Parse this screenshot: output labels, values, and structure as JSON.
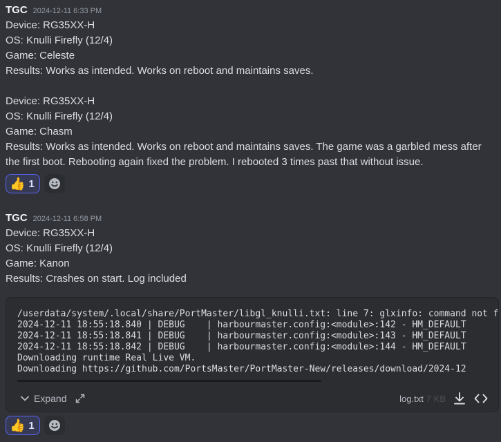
{
  "messages": [
    {
      "author": "TGC",
      "timestamp": "2024-12-11 6:33 PM",
      "block1": [
        "Device: RG35XX-H",
        "OS: Knulli Firefly (12/4)",
        "Game: Celeste",
        "Results: Works as intended. Works on reboot and maintains saves."
      ],
      "block2": [
        "Device: RG35XX-H",
        "OS: Knulli Firefly (12/4)",
        "Game: Chasm"
      ],
      "block2_results": "Results: Works as intended. Works on reboot and maintains saves. The game was a garbled mess after the first boot. Rebooting again fixed the problem. I rebooted 3 times past that without issue.",
      "reaction": {
        "emoji": "👍",
        "count": "1"
      }
    },
    {
      "author": "TGC",
      "timestamp": "2024-12-11 6:58 PM",
      "lines": [
        "Device: RG35XX-H",
        "OS: Knulli Firefly (12/4)",
        "Game: Kanon",
        "Results: Crashes on start. Log included"
      ],
      "attachment": {
        "preview_lines": [
          "/userdata/system/.local/share/PortMaster/libgl_knulli.txt: line 7: glxinfo: command not found",
          "2024-12-11 18:55:18.840 | DEBUG    | harbourmaster.config:<module>:142 - HM_DEFAULT",
          "2024-12-11 18:55:18.841 | DEBUG    | harbourmaster.config:<module>:143 - HM_DEFAULT",
          "2024-12-11 18:55:18.842 | DEBUG    | harbourmaster.config:<module>:144 - HM_DEFAULT",
          "Downloading runtime Real Live VM.",
          "Downloading https://github.com/PortsMaster/PortMaster-New/releases/download/2024-12"
        ],
        "expand_label": "Expand",
        "filename": "log.txt",
        "filesize": "7 KB"
      },
      "reaction": {
        "emoji": "👍",
        "count": "1"
      }
    }
  ],
  "icons": {
    "add_reaction": "smile-icon",
    "expand": "chevron-down-icon",
    "fullscreen": "expand-arrows-icon",
    "download": "download-icon",
    "code": "code-icon"
  }
}
